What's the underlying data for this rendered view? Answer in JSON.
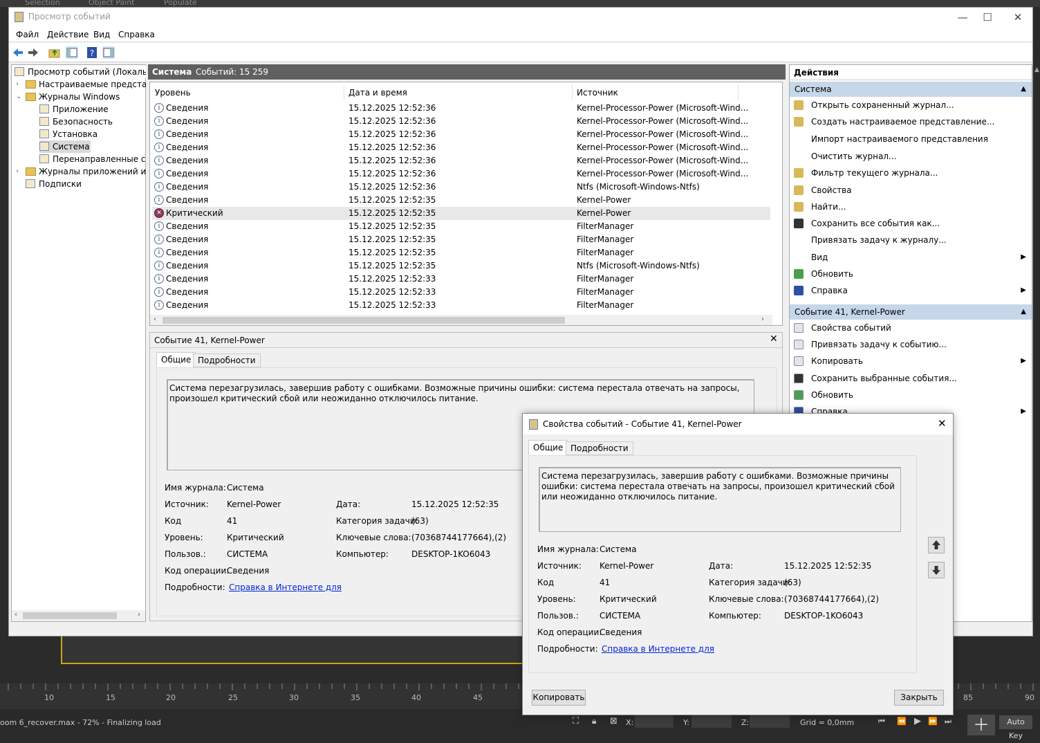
{
  "bg": {
    "top_tabs": [
      "Selection",
      "Object Paint",
      "Populate"
    ]
  },
  "window": {
    "title": "Просмотр событий",
    "btn_min": "—",
    "btn_max": "☐",
    "btn_close": "✕"
  },
  "menu": [
    "Файл",
    "Действие",
    "Вид",
    "Справка"
  ],
  "tree": {
    "root": "Просмотр событий (Локальный)",
    "custom_views": "Настраиваемые представления",
    "windows_logs": "Журналы Windows",
    "app": "Приложение",
    "security": "Безопасность",
    "setup": "Установка",
    "system": "Система",
    "forwarded": "Перенаправленные события",
    "app_logs": "Журналы приложений и служб",
    "subscriptions": "Подписки"
  },
  "mid": {
    "log_name": "Система",
    "count_label": "Событий: 15 259"
  },
  "columns": {
    "level": "Уровень",
    "datetime": "Дата и время",
    "source": "Источник"
  },
  "events": [
    {
      "level": "Сведения",
      "datetime": "15.12.2025 12:52:36",
      "source": "Kernel-Processor-Power (Microsoft-Wind..."
    },
    {
      "level": "Сведения",
      "datetime": "15.12.2025 12:52:36",
      "source": "Kernel-Processor-Power (Microsoft-Wind..."
    },
    {
      "level": "Сведения",
      "datetime": "15.12.2025 12:52:36",
      "source": "Kernel-Processor-Power (Microsoft-Wind..."
    },
    {
      "level": "Сведения",
      "datetime": "15.12.2025 12:52:36",
      "source": "Kernel-Processor-Power (Microsoft-Wind..."
    },
    {
      "level": "Сведения",
      "datetime": "15.12.2025 12:52:36",
      "source": "Kernel-Processor-Power (Microsoft-Wind..."
    },
    {
      "level": "Сведения",
      "datetime": "15.12.2025 12:52:36",
      "source": "Kernel-Processor-Power (Microsoft-Wind..."
    },
    {
      "level": "Сведения",
      "datetime": "15.12.2025 12:52:36",
      "source": "Ntfs (Microsoft-Windows-Ntfs)"
    },
    {
      "level": "Сведения",
      "datetime": "15.12.2025 12:52:35",
      "source": "Kernel-Power"
    },
    {
      "level": "Критический",
      "datetime": "15.12.2025 12:52:35",
      "source": "Kernel-Power"
    },
    {
      "level": "Сведения",
      "datetime": "15.12.2025 12:52:35",
      "source": "FilterManager"
    },
    {
      "level": "Сведения",
      "datetime": "15.12.2025 12:52:35",
      "source": "FilterManager"
    },
    {
      "level": "Сведения",
      "datetime": "15.12.2025 12:52:35",
      "source": "FilterManager"
    },
    {
      "level": "Сведения",
      "datetime": "15.12.2025 12:52:35",
      "source": "Ntfs (Microsoft-Windows-Ntfs)"
    },
    {
      "level": "Сведения",
      "datetime": "15.12.2025 12:52:33",
      "source": "FilterManager"
    },
    {
      "level": "Сведения",
      "datetime": "15.12.2025 12:52:33",
      "source": "FilterManager"
    },
    {
      "level": "Сведения",
      "datetime": "15.12.2025 12:52:33",
      "source": "FilterManager"
    }
  ],
  "detail": {
    "title": "Событие 41, Kernel-Power",
    "tab_general": "Общие",
    "tab_details": "Подробности",
    "message": "Система перезагрузилась, завершив работу с ошибками. Возможные причины ошибки: система перестала отвечать на запросы, произошел критический сбой или неожиданно отключилось питание.",
    "l_log": "Имя журнала:",
    "v_log": "Система",
    "l_source": "Источник:",
    "v_source": "Kernel-Power",
    "l_date": "Дата:",
    "v_date": "15.12.2025 12:52:35",
    "l_code": "Код",
    "v_code": "41",
    "l_cat": "Категория задачи:",
    "v_cat": "(63)",
    "l_level": "Уровень:",
    "v_level": "Критический",
    "l_kw": "Ключевые слова:",
    "v_kw": "(70368744177664),(2)",
    "l_user": "Пользов.:",
    "v_user": "СИСТЕМА",
    "l_pc": "Компьютер:",
    "v_pc": "DESKTOP-1KO6043",
    "l_op": "Код операции:",
    "v_op": "Сведения",
    "l_more": "Подробности:",
    "v_more": "Справка в Интернете для "
  },
  "actions": {
    "header": "Действия",
    "sec1": "Система",
    "items1": [
      "Открыть сохраненный журнал...",
      "Создать настраиваемое представление...",
      "Импорт настраиваемого представления",
      "Очистить журнал...",
      "Фильтр текущего журнала...",
      "Свойства",
      "Найти...",
      "Сохранить все события как...",
      "Привязать задачу к журналу...",
      "Вид",
      "Обновить",
      "Справка"
    ],
    "sec2": "Событие 41, Kernel-Power",
    "items2": [
      "Свойства событий",
      "Привязать задачу к событию...",
      "Копировать",
      "Сохранить выбранные события...",
      "Обновить",
      "Справка"
    ]
  },
  "dialog": {
    "title": "Свойства событий - Событие 41, Kernel-Power",
    "copy_btn": "Копировать",
    "close_btn": "Закрыть"
  },
  "bottom": {
    "ruler": [
      "10",
      "15",
      "20",
      "25",
      "30",
      "35",
      "40",
      "45",
      "85",
      "90"
    ],
    "status": "oom 6_recover.max  -  72%  -  Finalizing load",
    "x": "X:",
    "y": "Y:",
    "z": "Z:",
    "grid": "Grid = 0,0mm",
    "autokey": "Auto Key"
  }
}
